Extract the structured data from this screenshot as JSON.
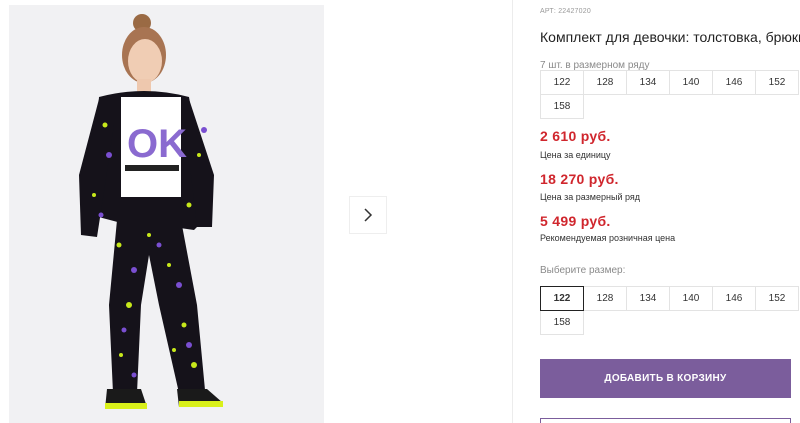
{
  "gallery": {
    "next_icon": "chevron-right-icon",
    "photo_alt": "girl-in-tracksuit-photo"
  },
  "product": {
    "sku": "АРТ: 22427020",
    "title": "Комплект для девочки: толстовка, брюки",
    "size_row_caption": "7 шт. в размерном ряду",
    "size_row": [
      "122",
      "128",
      "134",
      "140",
      "146",
      "152",
      "158"
    ]
  },
  "prices": {
    "unit_price": "2 610 руб.",
    "unit_price_note": "Цена за единицу",
    "row_price": "18 270 руб.",
    "row_price_note": "Цена за размерный ряд",
    "retail_price": "5 499 руб.",
    "retail_price_note": "Рекомендуемая розничная цена"
  },
  "size_selector": {
    "label": "Выберите размер:",
    "options": [
      "122",
      "128",
      "134",
      "140",
      "146",
      "152",
      "158"
    ],
    "selected": "122"
  },
  "actions": {
    "add_to_cart": "ДОБАВИТЬ В КОРЗИНУ"
  },
  "colors": {
    "accent": "#7b5d9c",
    "price": "#d0262d"
  }
}
